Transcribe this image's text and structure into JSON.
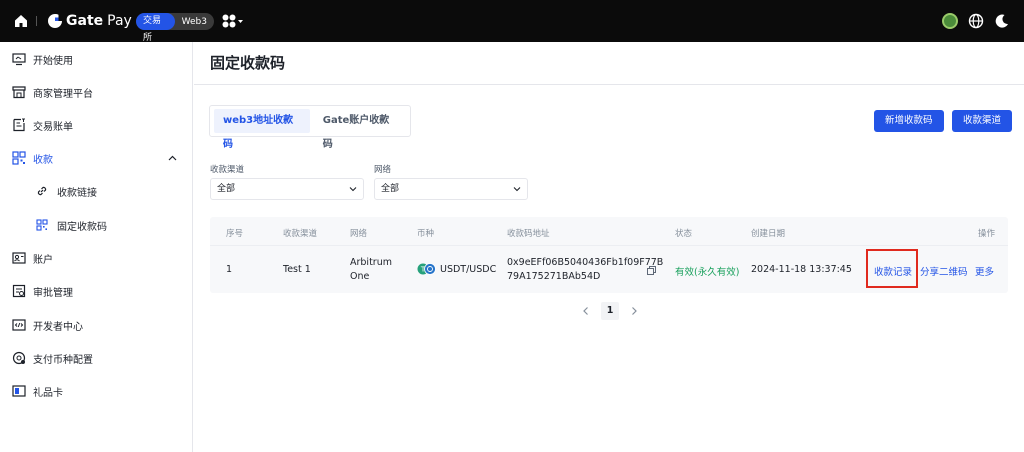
{
  "topbar": {
    "brand": "Gate",
    "brand_suffix": "Pay",
    "switch_on": "交易所",
    "switch_off": "Web3"
  },
  "sidebar": {
    "items": [
      {
        "label": "开始使用",
        "icon": "monitor-icon"
      },
      {
        "label": "商家管理平台",
        "icon": "store-icon"
      },
      {
        "label": "交易账单",
        "icon": "bill-icon"
      },
      {
        "label": "收款",
        "icon": "qrcode-grid-icon"
      },
      {
        "label": "收款链接",
        "icon": "link-icon"
      },
      {
        "label": "固定收款码",
        "icon": "qrcode-icon"
      },
      {
        "label": "账户",
        "icon": "account-icon"
      },
      {
        "label": "审批管理",
        "icon": "approval-icon"
      },
      {
        "label": "开发者中心",
        "icon": "code-icon"
      },
      {
        "label": "支付币种配置",
        "icon": "coin-config-icon"
      },
      {
        "label": "礼品卡",
        "icon": "giftcard-icon"
      }
    ]
  },
  "main": {
    "title": "固定收款码",
    "tabs": [
      "web3地址收款码",
      "Gate账户收款码"
    ],
    "buttons": {
      "add": "新增收款码",
      "channel": "收款渠道"
    },
    "filters": [
      {
        "label": "收款渠道",
        "value": "全部"
      },
      {
        "label": "网络",
        "value": "全部"
      }
    ],
    "table": {
      "headers": [
        "序号",
        "收款渠道",
        "网络",
        "币种",
        "收款码地址",
        "状态",
        "创建日期",
        "操作"
      ],
      "row": {
        "index": "1",
        "channel": "Test 1",
        "network_line1": "Arbitrum",
        "network_line2": "One",
        "coin": "USDT/USDC",
        "address_line1": "0x9eEFf06B5040436Fb1f09F77B",
        "address_line2": "79A175271BAb54D",
        "status": "有效(永久有效)",
        "created": "2024-11-18 13:37:45",
        "actions": [
          "收款记录",
          "分享二维码",
          "更多"
        ]
      }
    },
    "pager": {
      "current": "1"
    }
  }
}
